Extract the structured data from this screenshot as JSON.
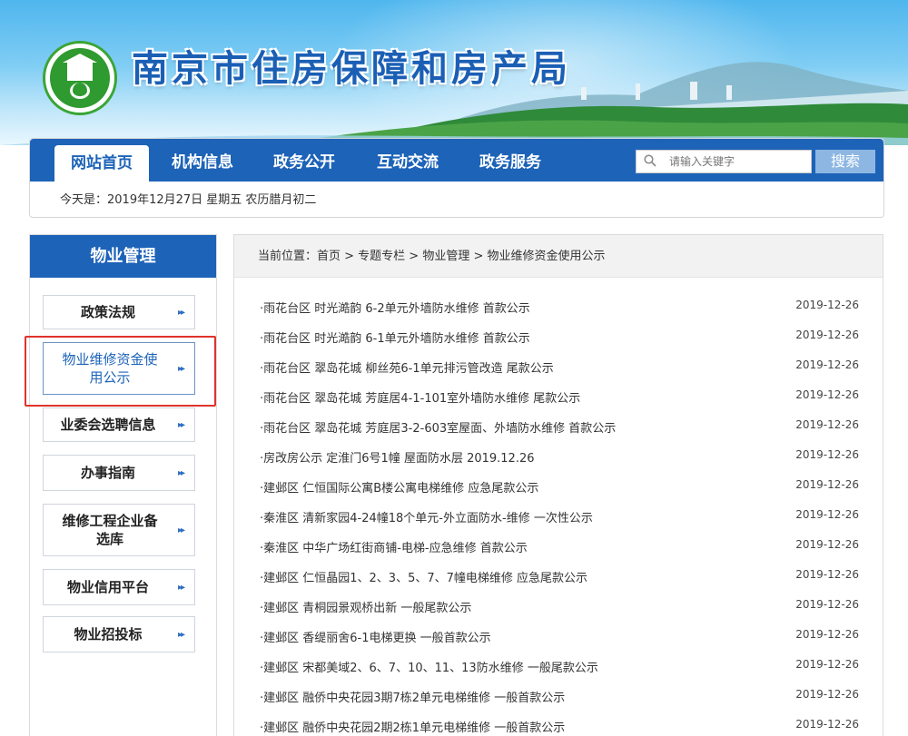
{
  "header": {
    "site_title": "南京市住房保障和房产局"
  },
  "nav": {
    "items": [
      "网站首页",
      "机构信息",
      "政务公开",
      "互动交流",
      "政务服务"
    ],
    "search_placeholder": "请输入关键字",
    "search_button": "搜索",
    "date_text": "今天是：2019年12月27日 星期五  农历腊月初二"
  },
  "sidebar": {
    "title": "物业管理",
    "items": [
      "政策法规",
      "物业维修资金使用公示",
      "业委会选聘信息",
      "办事指南",
      "维修工程企业备选库",
      "物业信用平台",
      "物业招投标"
    ],
    "arrow": "▸▸"
  },
  "breadcrumb": "当前位置：首页 > 专题专栏 > 物业管理 > 物业维修资金使用公示",
  "notices": [
    {
      "title": "·雨花台区 时光澔韵 6-2单元外墙防水维修 首款公示",
      "date": "2019-12-26"
    },
    {
      "title": "·雨花台区 时光澔韵 6-1单元外墙防水维修 首款公示",
      "date": "2019-12-26"
    },
    {
      "title": "·雨花台区 翠岛花城 柳丝苑6-1单元排污管改造 尾款公示",
      "date": "2019-12-26"
    },
    {
      "title": "·雨花台区 翠岛花城 芳庭居4-1-101室外墙防水维修 尾款公示",
      "date": "2019-12-26"
    },
    {
      "title": "·雨花台区 翠岛花城 芳庭居3-2-603室屋面、外墙防水维修 首款公示",
      "date": "2019-12-26"
    },
    {
      "title": "·房改房公示 定淮门6号1幢 屋面防水层 2019.12.26",
      "date": "2019-12-26"
    },
    {
      "title": "·建邺区 仁恒国际公寓B楼公寓电梯维修 应急尾款公示",
      "date": "2019-12-26"
    },
    {
      "title": "·秦淮区 清新家园4-24幢18个单元-外立面防水-维修 一次性公示",
      "date": "2019-12-26"
    },
    {
      "title": "·秦淮区 中华广场红街商铺-电梯-应急维修 首款公示",
      "date": "2019-12-26"
    },
    {
      "title": "·建邺区 仁恒晶园1、2、3、5、7、7幢电梯维修 应急尾款公示",
      "date": "2019-12-26"
    },
    {
      "title": "·建邺区 青桐园景观桥出新 一般尾款公示",
      "date": "2019-12-26"
    },
    {
      "title": "·建邺区 香缇丽舍6-1电梯更换 一般首款公示",
      "date": "2019-12-26"
    },
    {
      "title": "·建邺区 宋都美域2、6、7、10、11、13防水维修 一般尾款公示",
      "date": "2019-12-26"
    },
    {
      "title": "·建邺区 融侨中央花园3期7栋2单元电梯维修 一般首款公示",
      "date": "2019-12-26"
    },
    {
      "title": "·建邺区 融侨中央花园2期2栋1单元电梯维修 一般首款公示",
      "date": "2019-12-26"
    }
  ],
  "colors": {
    "primary": "#1d63b8",
    "highlight": "#e0322c"
  }
}
